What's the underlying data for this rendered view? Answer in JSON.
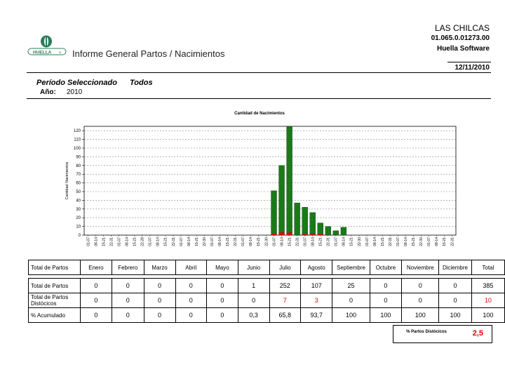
{
  "logo_text": "HUELLA",
  "report_title": "Informe General Partos / Nacimientos",
  "company": "LAS CHILCAS",
  "code": "01.065.0.01273.00",
  "software": "Huella Software",
  "date": "12/11/2010",
  "period": {
    "label": "Período Seleccionado",
    "value": "Todos"
  },
  "year": {
    "label": "Año:",
    "value": "2010"
  },
  "colors": {
    "bar": "#1a7a1a",
    "bar_edge": "#0a3a0a",
    "marker": "#e00000",
    "total_red": "#e00000"
  },
  "chart_data": {
    "type": "bar",
    "title": "Cantidad de Nacimientos",
    "ylabel": "Cantidad Nacimientos",
    "ylim": [
      0,
      125
    ],
    "yticks": [
      0,
      10,
      20,
      30,
      40,
      50,
      60,
      70,
      80,
      90,
      100,
      110,
      120
    ],
    "grid": true,
    "months": [
      "Enero",
      "Febrero",
      "Marzo",
      "Abril",
      "Mayo",
      "Junio",
      "Julio",
      "Agosto",
      "Septiembre",
      "Octubre",
      "Noviembre",
      "Diciembre"
    ],
    "period_labels": [
      "01-07",
      "08-14",
      "15-21",
      "22-31"
    ],
    "categories": [
      "01-07",
      "08-14",
      "15-21",
      "22-31",
      "01-07",
      "08-14",
      "15-21",
      "22-28",
      "01-07",
      "08-14",
      "15-21",
      "22-31",
      "01-07",
      "08-14",
      "15-21",
      "22-30",
      "01-07",
      "08-14",
      "15-21",
      "22-31",
      "01-07",
      "08-14",
      "15-21",
      "22-30",
      "01-07",
      "08-14",
      "15-21",
      "22-31",
      "01-07",
      "08-14",
      "15-21",
      "22-31",
      "01-07",
      "08-14",
      "15-21",
      "22-30",
      "01-07",
      "08-14",
      "15-21",
      "22-31",
      "01-07",
      "08-14",
      "15-21",
      "22-30",
      "01-07",
      "08-14",
      "15-21",
      "22-31"
    ],
    "values": [
      0,
      0,
      0,
      0,
      0,
      0,
      0,
      0,
      0,
      0,
      0,
      0,
      0,
      0,
      0,
      0,
      0,
      0,
      0,
      0,
      0,
      0,
      0,
      0,
      51,
      80,
      125,
      37,
      32,
      26,
      14,
      10,
      5,
      9,
      0,
      0,
      0,
      0,
      0,
      0,
      0,
      0,
      0,
      0,
      0,
      0,
      0,
      0
    ],
    "distocicos": [
      0,
      0,
      0,
      0,
      0,
      0,
      0,
      0,
      0,
      0,
      0,
      0,
      0,
      0,
      0,
      0,
      0,
      0,
      0,
      0,
      0,
      0,
      0,
      0,
      1,
      3,
      3,
      0,
      1,
      1,
      1,
      0,
      0,
      0,
      0,
      0,
      0,
      0,
      0,
      0,
      0,
      0,
      0,
      0,
      0,
      0,
      0,
      0
    ]
  },
  "table": {
    "header": [
      "Total de Partos",
      "Enero",
      "Febrero",
      "Marzo",
      "Abril",
      "Mayo",
      "Junio",
      "Julio",
      "Agosto",
      "Septiembre",
      "Octubre",
      "Noviembre",
      "Diciembre",
      "Total"
    ],
    "rows": [
      {
        "label": "Total de Partos",
        "values": [
          "0",
          "0",
          "0",
          "0",
          "0",
          "1",
          "252",
          "107",
          "25",
          "0",
          "0",
          "0",
          "385"
        ]
      },
      {
        "label": "Total de Partos Distócicos",
        "values": [
          "0",
          "0",
          "0",
          "0",
          "0",
          "0",
          "7",
          "3",
          "0",
          "0",
          "0",
          "0",
          "10"
        ]
      },
      {
        "label": "% Acumulado",
        "values": [
          "0",
          "0",
          "0",
          "0",
          "0",
          "0,3",
          "65,8",
          "93,7",
          "100",
          "100",
          "100",
          "100",
          "100"
        ]
      }
    ],
    "distocicos_pct": {
      "label": "% Partos Distócicos",
      "value": "2,5"
    }
  }
}
